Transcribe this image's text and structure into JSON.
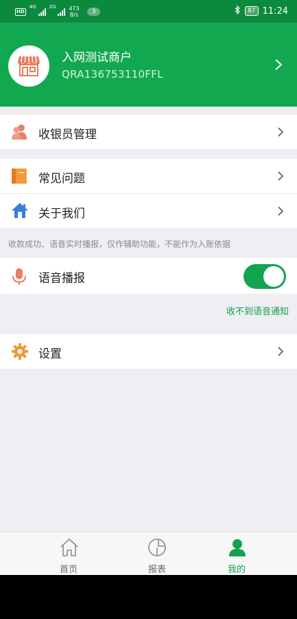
{
  "status_bar": {
    "hd": "HD",
    "net1": "4G",
    "net2": "2G",
    "speed_value": "473",
    "speed_unit": "B/s",
    "notification_count": "3",
    "battery": "87",
    "time": "11:24"
  },
  "header": {
    "merchant_name": "入网测试商户",
    "merchant_id": "QRA136753110FFL"
  },
  "menu": {
    "cashier": "收银员管理",
    "faq": "常见问题",
    "about": "关于我们",
    "settings": "设置"
  },
  "voice": {
    "notice": "收款成功、语音实时播报，仅作辅助功能，不能作为入账依据",
    "label": "语音播报",
    "enabled": true,
    "help_link": "收不到语音通知"
  },
  "tabs": [
    {
      "label": "首页",
      "icon": "home-icon",
      "active": false
    },
    {
      "label": "报表",
      "icon": "pie-chart-icon",
      "active": false
    },
    {
      "label": "我的",
      "icon": "user-icon",
      "active": true
    }
  ],
  "colors": {
    "primary": "#12a84f",
    "status_bar": "#0b8a3d",
    "accent_text": "#13a14d",
    "background": "#eeeef3"
  }
}
